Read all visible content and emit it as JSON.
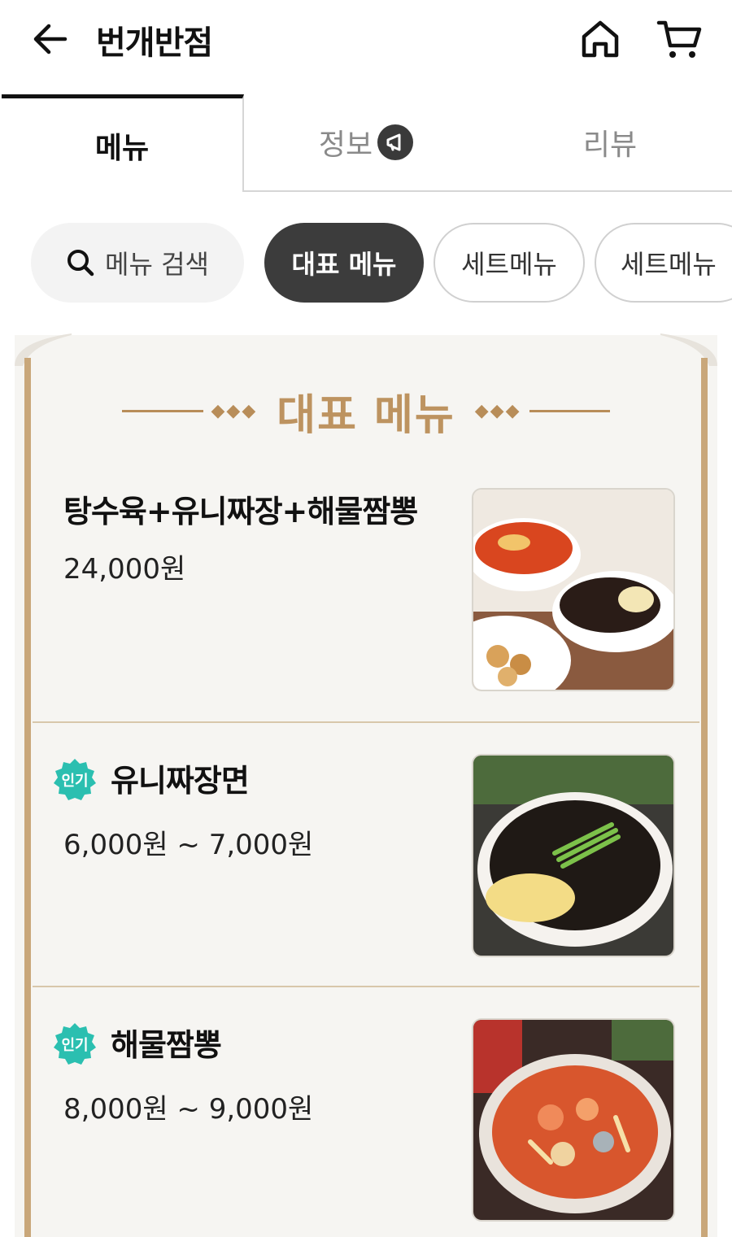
{
  "header": {
    "title": "번개반점",
    "icons": [
      "back-arrow-icon",
      "home-icon",
      "cart-icon"
    ]
  },
  "tabs": [
    {
      "label": "메뉴",
      "active": true
    },
    {
      "label": "정보",
      "active": false,
      "badge_icon": "megaphone-icon"
    },
    {
      "label": "리뷰",
      "active": false
    }
  ],
  "chips": {
    "search_label": "메뉴 검색",
    "items": [
      {
        "label": "대표 메뉴",
        "selected": true
      },
      {
        "label": "세트메뉴",
        "selected": false
      },
      {
        "label": "세트메뉴",
        "selected": false
      }
    ]
  },
  "section": {
    "title": "대표 메뉴"
  },
  "menu_items": [
    {
      "name": "탕수육+유니짜장+해물짬뽕",
      "price": "24,000원",
      "badge": "",
      "image": "set-dishes-photo"
    },
    {
      "name": "유니짜장면",
      "price": "6,000원 ~ 7,000원",
      "badge": "인기",
      "image": "jjajangmyeon-photo"
    },
    {
      "name": "해물짬뽕",
      "price": "8,000원 ~ 9,000원",
      "badge": "인기",
      "image": "jjamppong-photo"
    }
  ],
  "colors": {
    "accent_gold": "#bd9360",
    "badge_teal": "#2bbfb0",
    "chip_dark": "#3c3c3c"
  }
}
